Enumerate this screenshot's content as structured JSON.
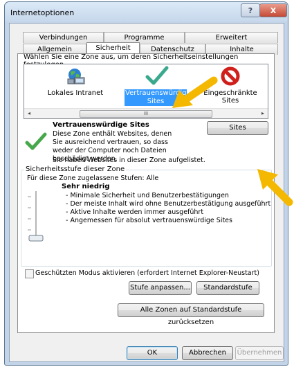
{
  "window": {
    "title": "Internetoptionen",
    "help_label": "?",
    "close_label": "X"
  },
  "tabs": {
    "back_row": [
      "Verbindungen",
      "Programme",
      "Erweitert"
    ],
    "front_row": [
      "Allgemein",
      "Sicherheit",
      "Datenschutz",
      "Inhalte"
    ],
    "active": "Sicherheit"
  },
  "security": {
    "zone_prompt": "Wählen Sie eine Zone aus, um deren Sicherheitseinstellungen festzulegen.",
    "zones": [
      {
        "label": "Lokales Intranet",
        "icon": "intranet-icon"
      },
      {
        "label": "Vertrauenswürdige Sites",
        "icon": "check-icon",
        "selected": true
      },
      {
        "label": "Eingeschränkte Sites",
        "icon": "blocked-icon"
      }
    ],
    "scroll_grip": "III",
    "scroll_left": "◂",
    "scroll_right": "▸",
    "zone_title": "Vertrauenswürdige Sites",
    "zone_desc": "Diese Zone enthält Websites, denen Sie ausreichend vertrauen, so dass weder der Computer noch Dateien beschädigt werden.",
    "zone_sites_note": "Sie haben Websites in dieser Zone aufgelistet.",
    "sites_button": "Sites",
    "level_group": "Sicherheitsstufe dieser Zone",
    "allowed_levels": "Für diese Zone zugelassene Stufen: Alle",
    "level_name": "Sehr niedrig",
    "level_details": [
      "- Minimale Sicherheit und Benutzerbestätigungen",
      "- Der meiste Inhalt wird ohne Benutzerbestätigung ausgeführt",
      "- Aktive Inhalte werden immer ausgeführt",
      "- Angemessen für absolut vertrauenswürdige Sites"
    ],
    "protected_mode_label": "Geschützten Modus aktivieren (erfordert Internet Explorer-Neustart)",
    "protected_mode_checked": false,
    "custom_level_button": "Stufe anpassen...",
    "default_level_button": "Standardstufe",
    "reset_all_button": "Alle Zonen auf Standardstufe zurücksetzen"
  },
  "footer": {
    "ok": "OK",
    "cancel": "Abbrechen",
    "apply": "Übernehmen"
  },
  "colors": {
    "selection": "#3399ff",
    "annotation_arrow": "#f5b800"
  }
}
